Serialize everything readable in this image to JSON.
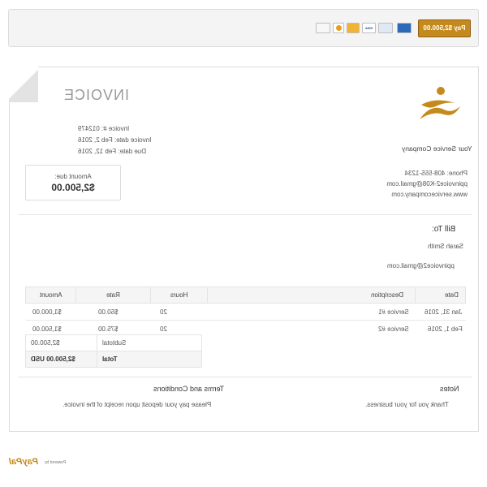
{
  "paybar": {
    "pay_button_label": "Pay $2,500.00",
    "cards": [
      "AMEX",
      "MasterCard",
      "VISA",
      "Discover",
      "Maestro",
      "Bank"
    ]
  },
  "invoice": {
    "title": "INVOICE",
    "meta": [
      {
        "label": "Invoice #:",
        "value": "012479"
      },
      {
        "label": "Invoice date:",
        "value": "Feb 2, 2016"
      },
      {
        "label": "Due date:",
        "value": "Feb 12, 2016"
      }
    ],
    "amount_due_label": "Amount due:",
    "amount_due_value": "$2,500.00"
  },
  "company": {
    "name": "Your Service Company",
    "phone": "Phone: 408-555-1234",
    "email": "ppinvoice2-K08@gmail.com",
    "website": "www.servicecompany.com"
  },
  "bill_to": {
    "heading": "Bill To:",
    "name": "Sarah Smith",
    "email": "ppinvoice2@gmail.com"
  },
  "table": {
    "headers": [
      "Date",
      "Description",
      "Hours",
      "Rate",
      "Amount"
    ],
    "rows": [
      [
        "Jan 31, 2016",
        "Service #1",
        "20",
        "$50.00",
        "$1,000.00"
      ],
      [
        "Feb 1, 2016",
        "Service #2",
        "20",
        "$75.00",
        "$1,500.00"
      ]
    ]
  },
  "totals": {
    "subtotal_label": "Subtotal",
    "subtotal_value": "$2,500.00",
    "total_label": "Total",
    "total_value": "$2,500.00 USD"
  },
  "notes": {
    "heading": "Notes",
    "text": "Thank you for your business."
  },
  "terms": {
    "heading": "Terms and Conditions",
    "text": "Please pay your deposit upon receipt of the invoice."
  },
  "footer": {
    "powered_by": "Powered by",
    "brand": "PayPal"
  },
  "colors": {
    "accent": "#c58a1d",
    "paypal_blue": "#003087",
    "paypal_light": "#009cde"
  }
}
